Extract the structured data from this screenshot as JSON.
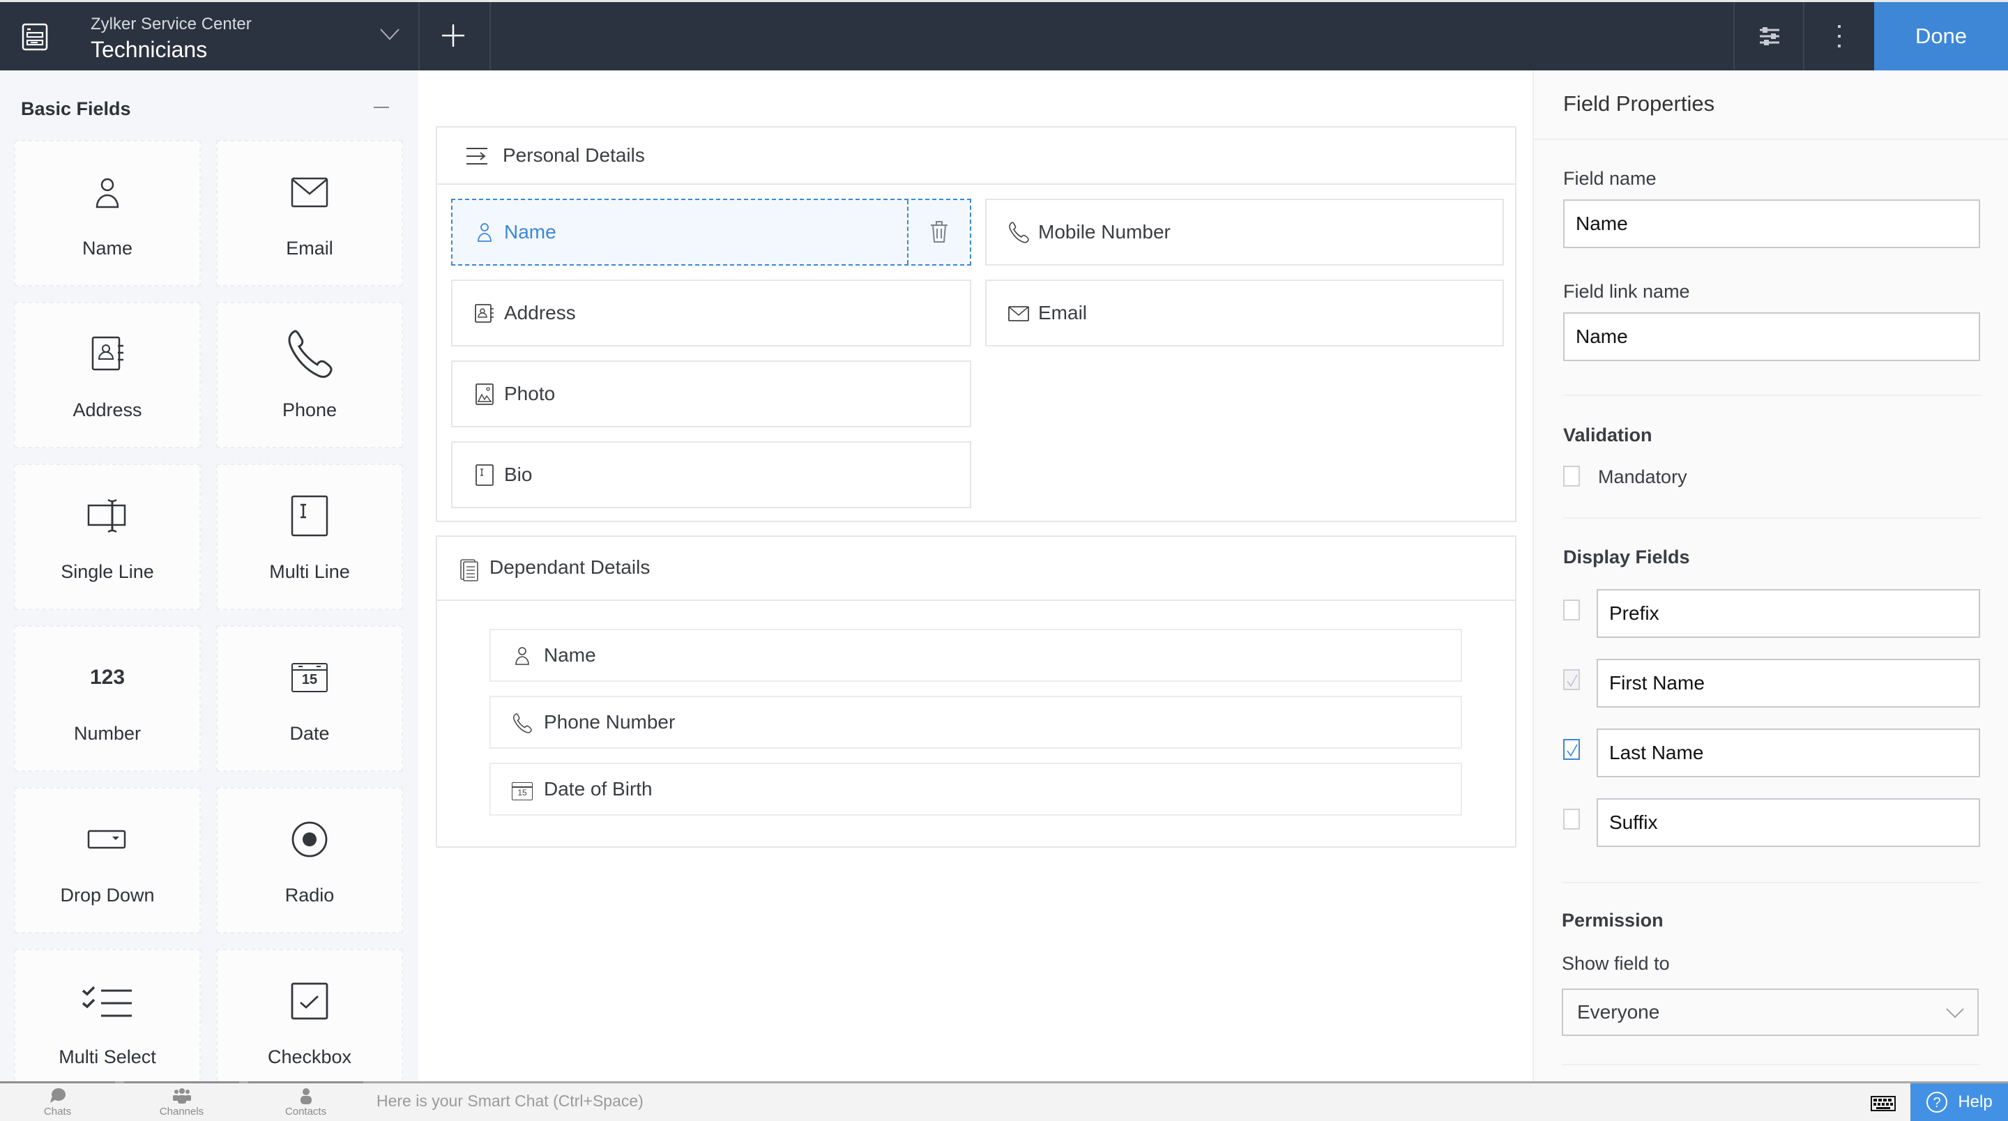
{
  "header": {
    "org_name": "Zylker Service Center",
    "form_title": "Technicians",
    "done_label": "Done",
    "icons": {
      "app": "form-icon",
      "switch": "chevron-down-icon",
      "add": "plus-icon",
      "settings": "sliders-icon",
      "more": "more-vertical-icon"
    }
  },
  "palette": {
    "title": "Basic Fields",
    "items": [
      {
        "label": "Name",
        "icon": "person-icon"
      },
      {
        "label": "Email",
        "icon": "envelope-icon"
      },
      {
        "label": "Address",
        "icon": "address-book-icon"
      },
      {
        "label": "Phone",
        "icon": "phone-icon"
      },
      {
        "label": "Single Line",
        "icon": "single-line-icon"
      },
      {
        "label": "Multi Line",
        "icon": "multi-line-icon"
      },
      {
        "label": "Number",
        "icon": "number-icon",
        "glyph": "123"
      },
      {
        "label": "Date",
        "icon": "calendar-icon",
        "glyph": "15"
      },
      {
        "label": "Drop Down",
        "icon": "dropdown-icon"
      },
      {
        "label": "Radio",
        "icon": "radio-icon"
      },
      {
        "label": "Multi Select",
        "icon": "multi-select-icon"
      },
      {
        "label": "Checkbox",
        "icon": "checkbox-icon"
      }
    ]
  },
  "canvas": {
    "sections": [
      {
        "title": "Personal Details",
        "icon": "section-icon",
        "fields": [
          {
            "label": "Name",
            "icon": "person-icon",
            "selected": true
          },
          {
            "label": "Mobile Number",
            "icon": "phone-icon"
          },
          {
            "label": "Address",
            "icon": "address-book-icon"
          },
          {
            "label": "Email",
            "icon": "envelope-icon"
          },
          {
            "label": "Photo",
            "icon": "image-icon"
          },
          {
            "label": "Bio",
            "icon": "multi-line-icon"
          }
        ]
      },
      {
        "title": "Dependant Details",
        "icon": "subform-icon",
        "fields": [
          {
            "label": "Name",
            "icon": "person-icon"
          },
          {
            "label": "Phone Number",
            "icon": "phone-icon"
          },
          {
            "label": "Date of Birth",
            "icon": "calendar-icon",
            "glyph": "15"
          }
        ]
      }
    ]
  },
  "properties": {
    "title": "Field Properties",
    "field_name_label": "Field name",
    "field_name_value": "Name",
    "field_link_label": "Field link name",
    "field_link_value": "Name",
    "validation_heading": "Validation",
    "mandatory_label": "Mandatory",
    "mandatory_checked": false,
    "display_heading": "Display Fields",
    "display_fields": [
      {
        "value": "Prefix",
        "checked": false,
        "disabled": false
      },
      {
        "value": "First Name",
        "checked": true,
        "disabled": true
      },
      {
        "value": "Last Name",
        "checked": true,
        "disabled": false
      },
      {
        "value": "Suffix",
        "checked": false,
        "disabled": false
      }
    ],
    "permission_heading": "Permission",
    "show_field_label": "Show field to",
    "show_field_value": "Everyone"
  },
  "bottom_bar": {
    "tabs": [
      {
        "label": "Chats",
        "icon": "chat-bubble-icon"
      },
      {
        "label": "Channels",
        "icon": "group-icon"
      },
      {
        "label": "Contacts",
        "icon": "contact-icon"
      }
    ],
    "smart_chat_placeholder": "Here is your Smart Chat (Ctrl+Space)",
    "help_label": "Help"
  },
  "colors": {
    "header_bg": "#2b3240",
    "accent": "#3d87d6",
    "help_bg": "#4391e4"
  }
}
